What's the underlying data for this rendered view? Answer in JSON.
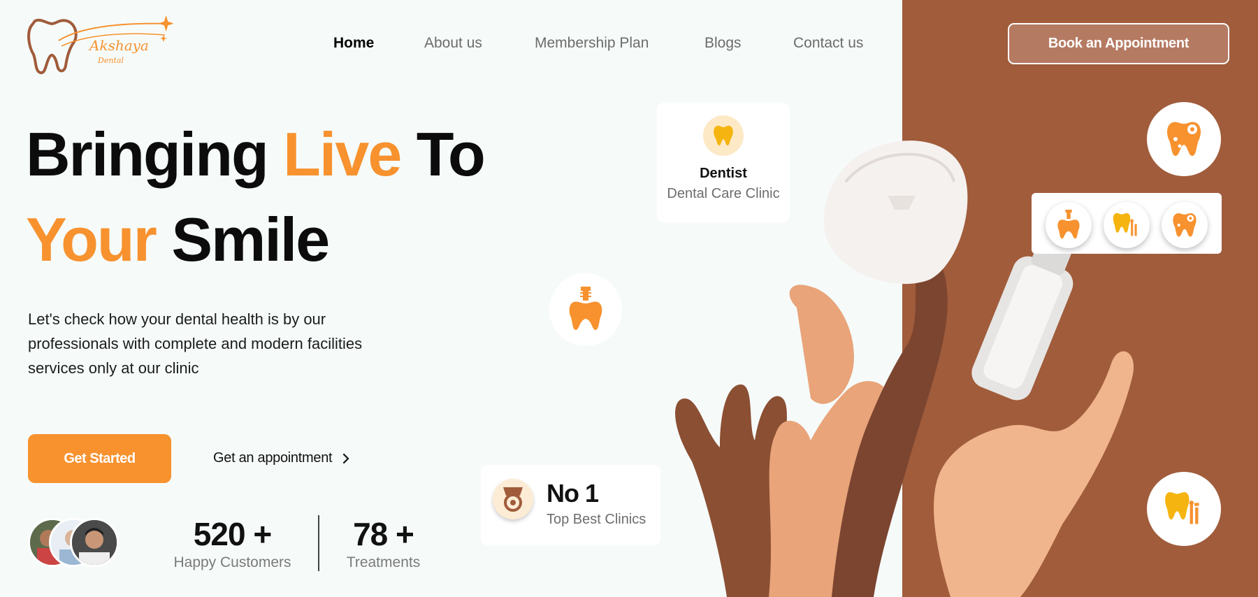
{
  "brand": {
    "logo_script": "Akshaya",
    "logo_sub": "Dental",
    "accent": "#f7922f",
    "panel_color": "#a05c3b"
  },
  "nav": {
    "items": [
      "Home",
      "About us",
      "Membership Plan",
      "Blogs",
      "Contact us"
    ],
    "active": "Home",
    "cta_label": "Book an Appointment"
  },
  "hero": {
    "title_w1": "Bringing",
    "title_w2": "Live",
    "title_w3": "To",
    "title_w4": "Your",
    "title_w5": "Smile",
    "description": "Let's check how your dental health is by our professionals with complete and modern facilities services only at our clinic",
    "primary_cta": "Get Started",
    "secondary_cta": "Get an appointment"
  },
  "stats": [
    {
      "number": "520 +",
      "label": "Happy Customers"
    },
    {
      "number": "78 +",
      "label": "Treatments"
    }
  ],
  "cards": {
    "dentist_title": "Dentist",
    "dentist_sub": "Dental Care Clinic",
    "rank_title": "No 1",
    "rank_sub": "Top Best Clinics"
  },
  "icons": {
    "dentist_card": "tooth-icon",
    "floating_left": "dental-implant-icon",
    "top_right": "tooth-cavity-icon",
    "row": [
      "dental-implant-icon",
      "tooth-tools-icon",
      "tooth-cavity-icon"
    ],
    "bottom_right": "tooth-tools-icon",
    "rank_card": "medal-icon",
    "secondary_cta_arrow": "chevron-right-icon"
  }
}
